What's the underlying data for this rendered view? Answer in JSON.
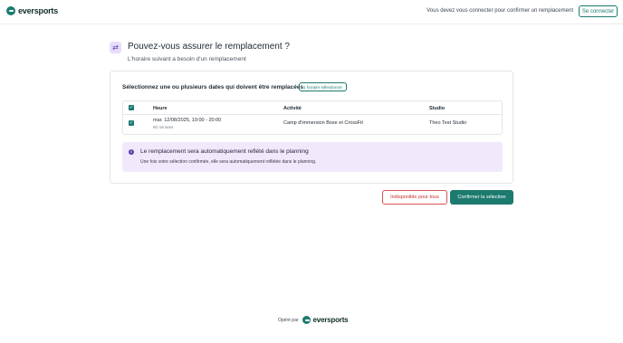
{
  "brand": {
    "name": "eversports",
    "color": "#1d7a6f"
  },
  "header": {
    "login_message": "Vous devez vous connecter pour confirmer un remplacement",
    "login_button": "Se connecter"
  },
  "page": {
    "icon": "swap-arrows-icon",
    "title": "Pouvez-vous assurer le remplacement ?",
    "subtitle": "L'horaire suivant a besoin d'un remplacement"
  },
  "selection": {
    "label": "Sélectionnez une ou plusieurs dates qui doivent être remplacées",
    "badge": "1 horaire sélectionné",
    "columns": [
      "Heure",
      "Activité",
      "Studio"
    ],
    "rows": [
      {
        "checked": true,
        "time": "mar. 12/08/2025, 19:00 - 20:00",
        "duration": "60 minutes",
        "activity": "Camp d'immersion Boxe et CrossFit",
        "studio": "Theo Test Studio"
      }
    ]
  },
  "info": {
    "icon": "info-icon",
    "title": "Le remplacement sera automatiquement reflété dans le planning",
    "body": "Une fois votre sélection confirmée, elle sera automatiquement reflétée dans le planning."
  },
  "actions": {
    "unavailable": "Indisponible pour tous",
    "confirm": "Confirmer la sélection"
  },
  "footer": {
    "label": "Opéré par",
    "brand": "eversports"
  }
}
